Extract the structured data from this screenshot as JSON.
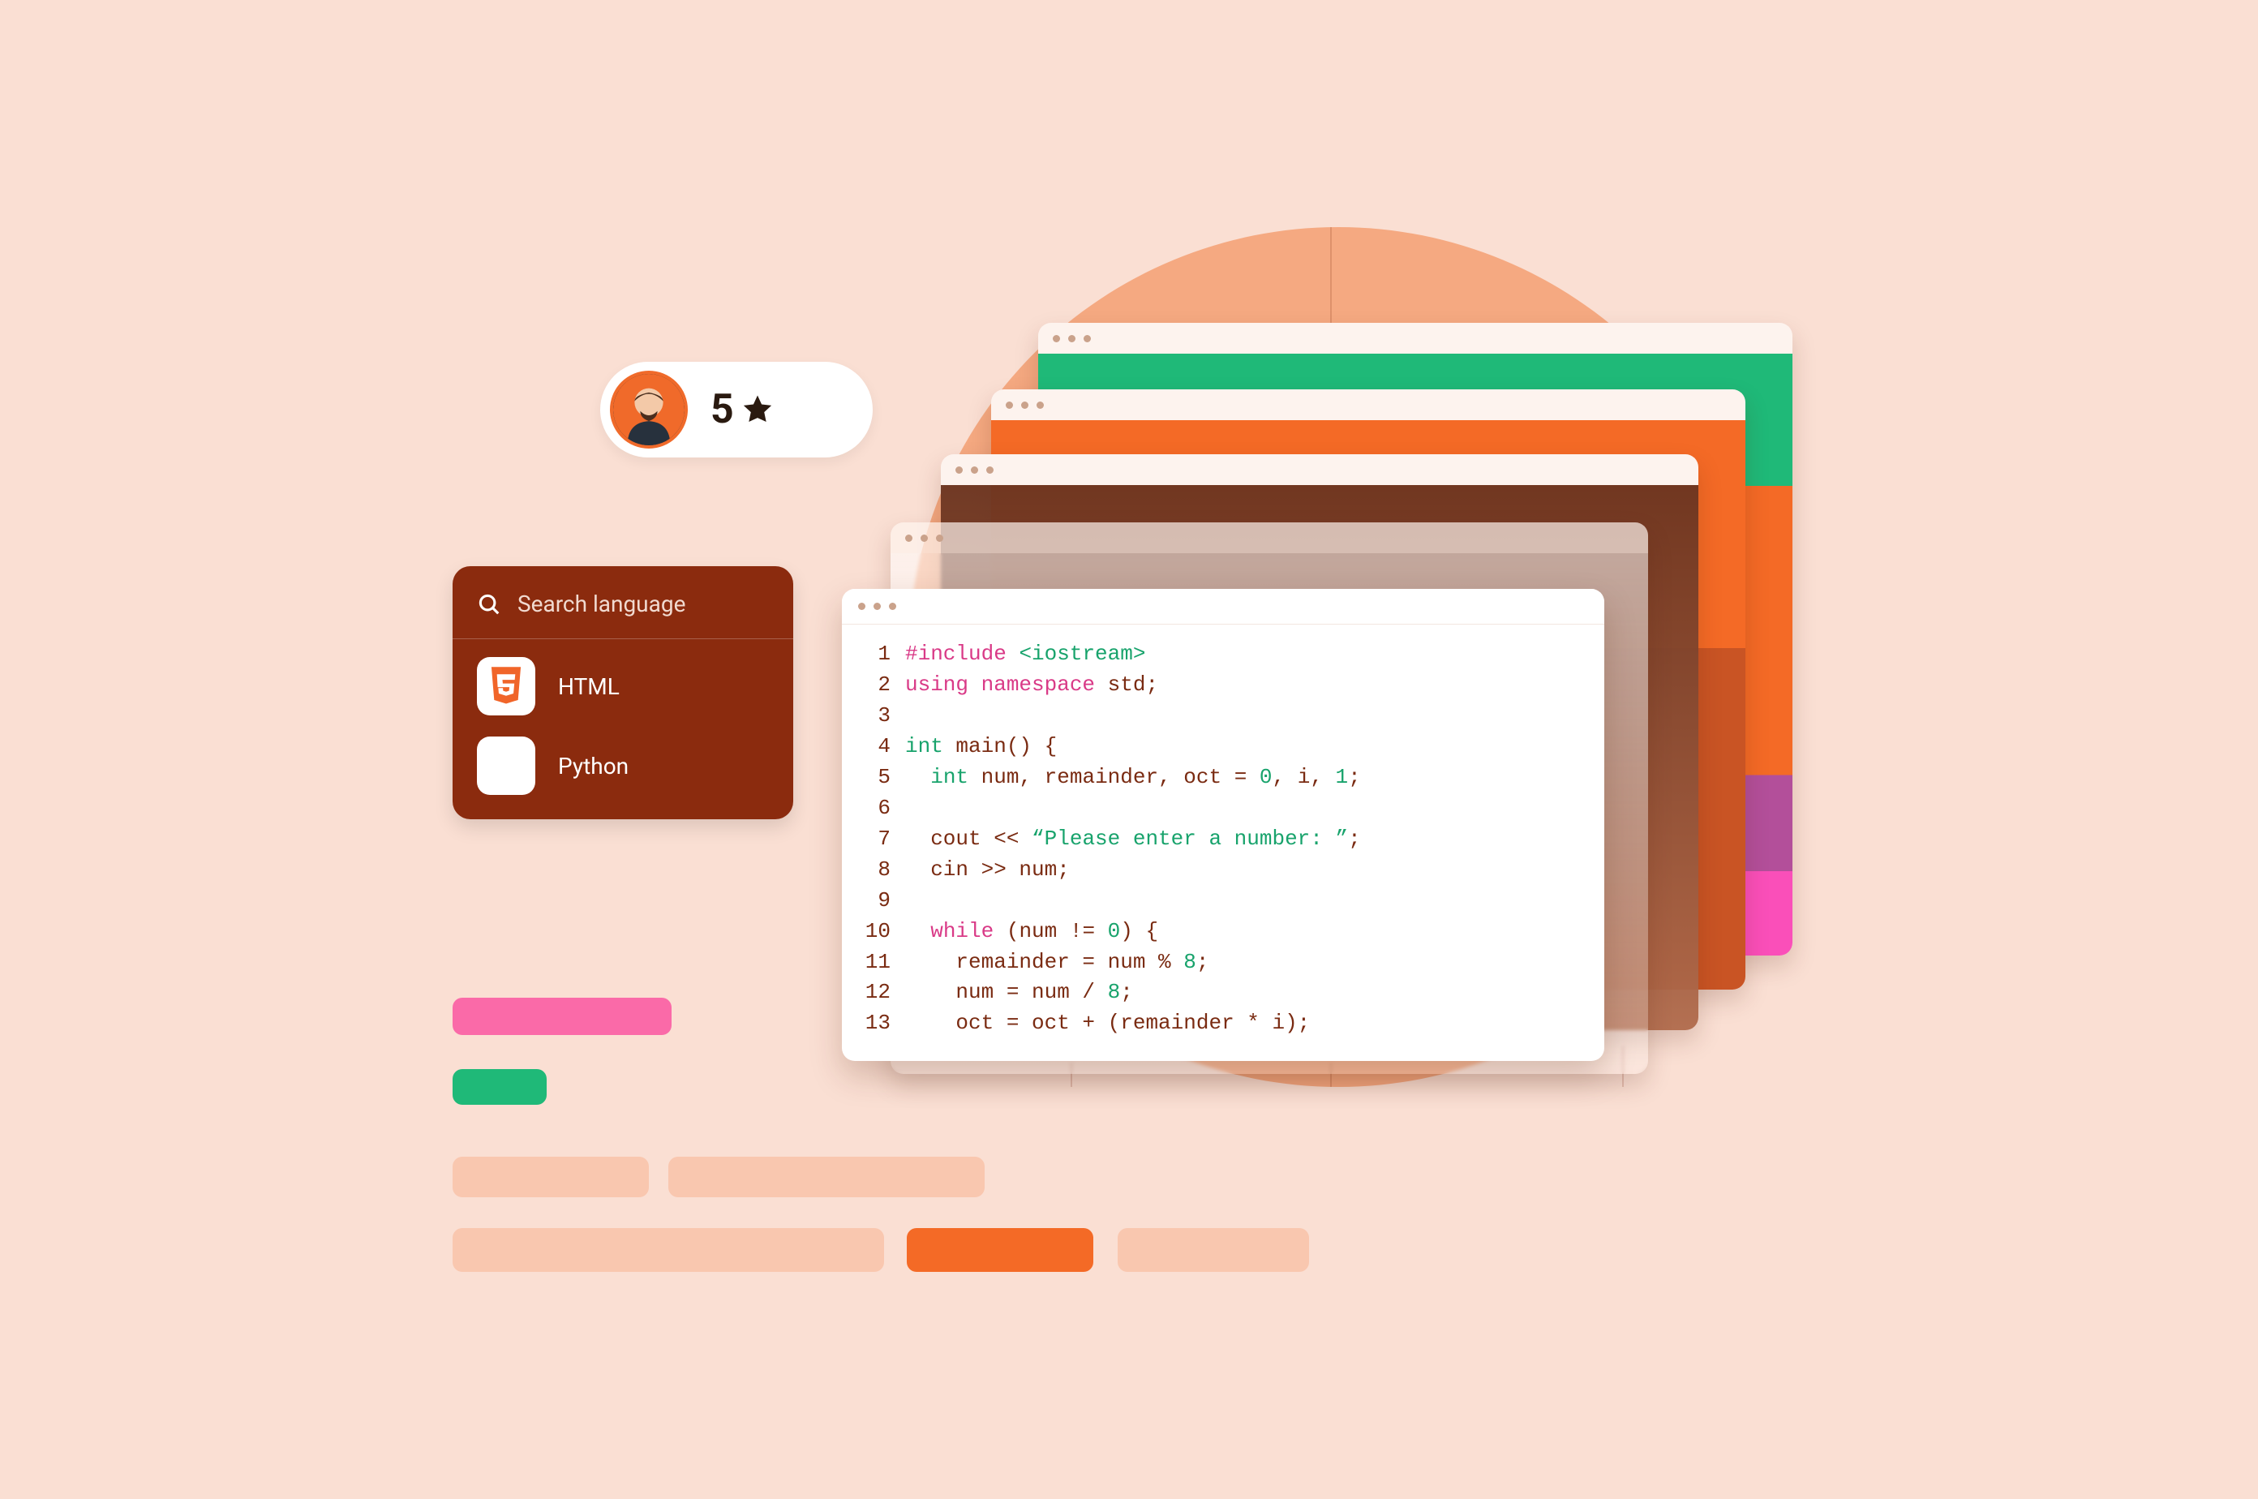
{
  "rating": {
    "value": "5",
    "icon": "star-icon"
  },
  "language_panel": {
    "search_placeholder": "Search language",
    "items": [
      {
        "icon": "html5-icon",
        "label": "HTML"
      },
      {
        "icon": "python-icon",
        "label": "Python"
      }
    ]
  },
  "colors": {
    "background": "#fadfd3",
    "circle": "#f5a981",
    "panel": "#8b2b0e",
    "pink": "#fa6aa8",
    "green": "#1fb978",
    "orange": "#f46a26",
    "peach": "#f9c7af"
  },
  "code": {
    "lines": [
      {
        "n": "1",
        "segments": [
          {
            "t": "#include ",
            "c": "tok-include"
          },
          {
            "t": "<iostream>",
            "c": "tok-angle"
          }
        ]
      },
      {
        "n": "2",
        "segments": [
          {
            "t": "using namespace ",
            "c": "tok-keyword"
          },
          {
            "t": "std;",
            "c": "tok-default"
          }
        ]
      },
      {
        "n": "3",
        "segments": [
          {
            "t": "",
            "c": "tok-default"
          }
        ]
      },
      {
        "n": "4",
        "segments": [
          {
            "t": "int ",
            "c": "tok-type"
          },
          {
            "t": "main() {",
            "c": "tok-default"
          }
        ]
      },
      {
        "n": "5",
        "segments": [
          {
            "t": "  ",
            "c": "tok-default"
          },
          {
            "t": "int ",
            "c": "tok-type"
          },
          {
            "t": "num, remainder, oct = ",
            "c": "tok-default"
          },
          {
            "t": "0",
            "c": "tok-num"
          },
          {
            "t": ", i, ",
            "c": "tok-default"
          },
          {
            "t": "1",
            "c": "tok-num"
          },
          {
            "t": ";",
            "c": "tok-default"
          }
        ]
      },
      {
        "n": "6",
        "segments": [
          {
            "t": "",
            "c": "tok-default"
          }
        ]
      },
      {
        "n": "7",
        "segments": [
          {
            "t": "  cout << ",
            "c": "tok-default"
          },
          {
            "t": "“Please enter a number: ”",
            "c": "tok-string"
          },
          {
            "t": ";",
            "c": "tok-default"
          }
        ]
      },
      {
        "n": "8",
        "segments": [
          {
            "t": "  cin >> num;",
            "c": "tok-default"
          }
        ]
      },
      {
        "n": "9",
        "segments": [
          {
            "t": "",
            "c": "tok-default"
          }
        ]
      },
      {
        "n": "10",
        "segments": [
          {
            "t": "  ",
            "c": "tok-default"
          },
          {
            "t": "while ",
            "c": "tok-keyword"
          },
          {
            "t": "(num != ",
            "c": "tok-default"
          },
          {
            "t": "0",
            "c": "tok-num"
          },
          {
            "t": ") {",
            "c": "tok-default"
          }
        ]
      },
      {
        "n": "11",
        "segments": [
          {
            "t": "    remainder = num % ",
            "c": "tok-default"
          },
          {
            "t": "8",
            "c": "tok-num"
          },
          {
            "t": ";",
            "c": "tok-default"
          }
        ]
      },
      {
        "n": "12",
        "segments": [
          {
            "t": "    num = num / ",
            "c": "tok-default"
          },
          {
            "t": "8",
            "c": "tok-num"
          },
          {
            "t": ";",
            "c": "tok-default"
          }
        ]
      },
      {
        "n": "13",
        "segments": [
          {
            "t": "    oct = oct + (remainder * i);",
            "c": "tok-default"
          }
        ]
      }
    ]
  }
}
